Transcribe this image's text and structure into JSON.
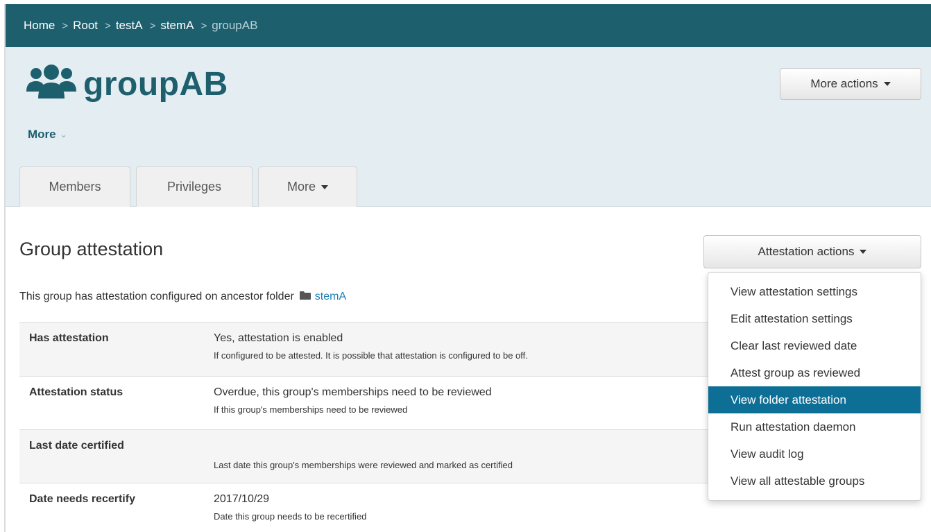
{
  "breadcrumb": [
    {
      "label": "Home"
    },
    {
      "label": "Root"
    },
    {
      "label": "testA"
    },
    {
      "label": "stemA"
    },
    {
      "label": "groupAB"
    }
  ],
  "breadcrumb_separator": ">",
  "header": {
    "title": "groupAB",
    "title_icon": "users-icon",
    "more_link": "More",
    "more_actions_label": "More actions"
  },
  "tabs": [
    {
      "label": "Members"
    },
    {
      "label": "Privileges"
    },
    {
      "label": "More"
    }
  ],
  "section": {
    "title": "Group attestation",
    "actions_label": "Attestation actions",
    "note_text": "This group has attestation configured on ancestor folder",
    "note_folder_icon": "folder-icon",
    "note_link": "stemA"
  },
  "properties": [
    {
      "label": "Has attestation",
      "value": "Yes, attestation is enabled",
      "help": "If configured to be attested. It is possible that attestation is configured to be off."
    },
    {
      "label": "Attestation status",
      "value": "Overdue, this group's memberships need to be reviewed",
      "help": "If this group's memberships need to be reviewed"
    },
    {
      "label": "Last date certified",
      "value": "",
      "help": "Last date this group's memberships were reviewed and marked as certified"
    },
    {
      "label": "Date needs recertify",
      "value": "2017/10/29",
      "help": "Date this group needs to be recertified"
    }
  ],
  "menu": {
    "items": [
      {
        "label": "View attestation settings"
      },
      {
        "label": "Edit attestation settings"
      },
      {
        "label": "Clear last reviewed date"
      },
      {
        "label": "Attest group as reviewed"
      },
      {
        "label": "View folder attestation"
      },
      {
        "label": "Run attestation daemon"
      },
      {
        "label": "View audit log"
      },
      {
        "label": "View all attestable groups"
      }
    ],
    "highlighted": "View folder attestation"
  },
  "colors": {
    "brand": "#1e5f6e",
    "header_bg": "#e4edf1",
    "link": "#1a7fb5",
    "menu_highlight": "#0e6f96"
  }
}
